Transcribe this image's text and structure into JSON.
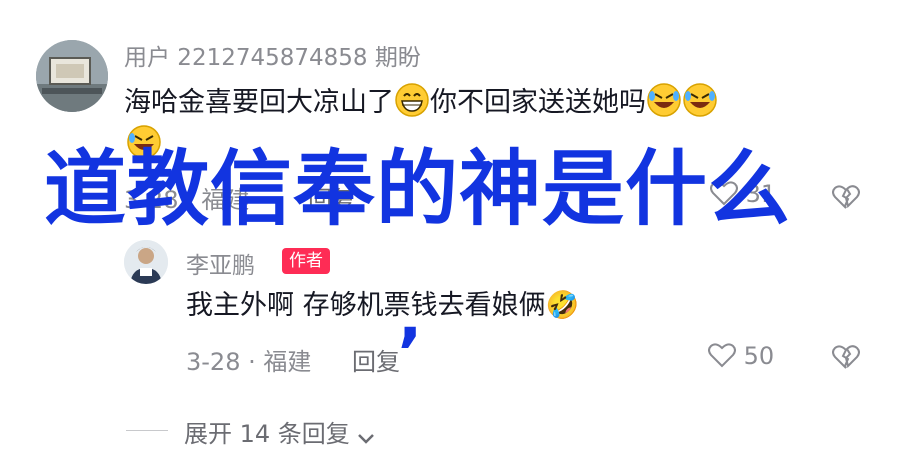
{
  "comment": {
    "username": "用户 2212745874858 期盼",
    "text": "海哈金喜要回大凉山了😁你不回家送送她吗🤣🤣",
    "text_part1": "海哈金喜要回大凉山了",
    "text_part2": "你不回家送送她吗",
    "meta": "3-28 · 福建",
    "reply_label": "回复",
    "likes": "31",
    "emoji_icons": [
      "grin-emoji-icon",
      "rofl-emoji-icon"
    ]
  },
  "reply": {
    "username": "李亚鹏",
    "badge": "作者",
    "text": "我主外啊 存够机票钱去看娘俩🤣",
    "meta": "3-28 · 福建",
    "reply_label": "回复",
    "likes": "50"
  },
  "expand": {
    "label": "展开 14 条回复"
  },
  "overlay": {
    "title": "道教信奉的神是什么",
    "comma": ","
  },
  "colors": {
    "overlay_blue": "#1234e0",
    "badge_red": "#fe2c55",
    "text_gray": "#8a8b91"
  }
}
